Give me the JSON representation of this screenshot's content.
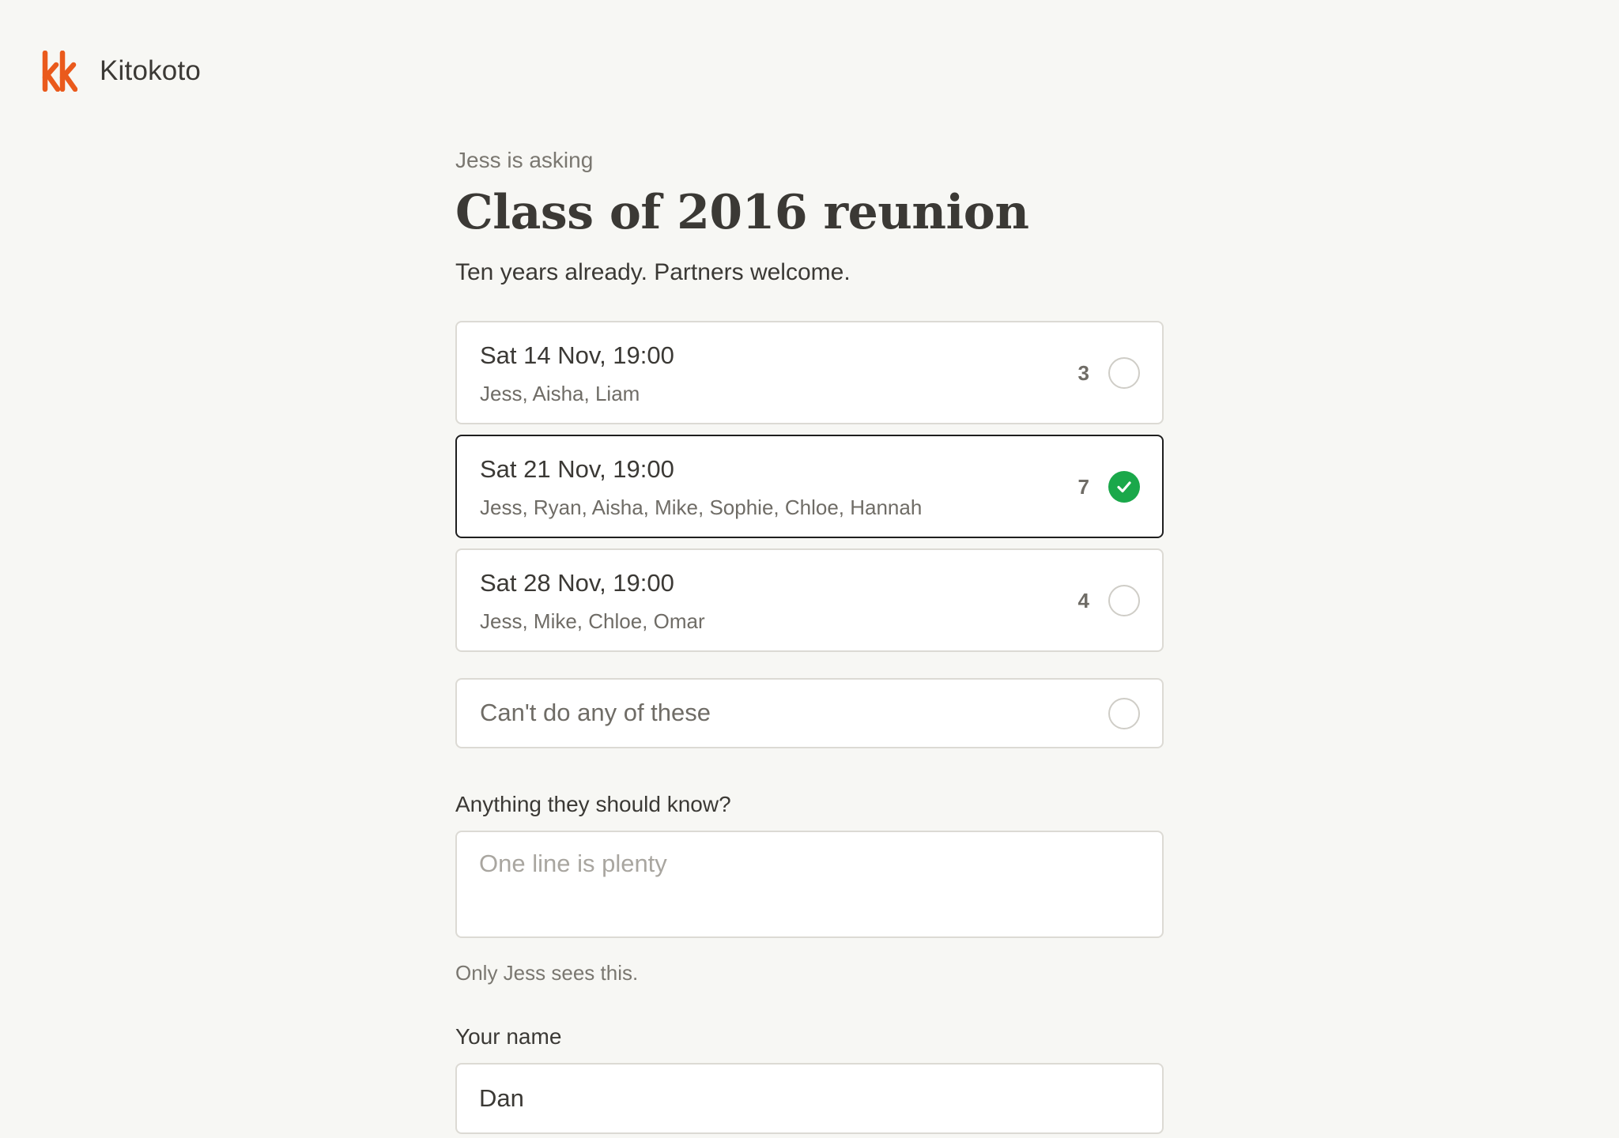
{
  "brand": {
    "name": "Kitokoto",
    "logo_icon": "kk-logo-icon",
    "accent_color": "#ea5a1c"
  },
  "poll": {
    "asker": "Jess is asking",
    "title": "Class of 2016 reunion",
    "description": "Ten years already. Partners welcome."
  },
  "options": [
    {
      "date": "Sat 14 Nov, 19:00",
      "people": "Jess, Aisha, Liam",
      "count": "3",
      "selected": false
    },
    {
      "date": "Sat 21 Nov, 19:00",
      "people": "Jess, Ryan, Aisha, Mike, Sophie, Chloe, Hannah",
      "count": "7",
      "selected": true
    },
    {
      "date": "Sat 28 Nov, 19:00",
      "people": "Jess, Mike, Chloe, Omar",
      "count": "4",
      "selected": false
    }
  ],
  "none_option": {
    "label": "Can't do any of these",
    "selected": false
  },
  "note": {
    "label": "Anything they should know?",
    "placeholder": "One line is plenty",
    "value": "",
    "hint": "Only Jess sees this."
  },
  "name_field": {
    "label": "Your name",
    "value": "Dan"
  },
  "colors": {
    "selected_check": "#1aa84a",
    "selected_border": "#1f1f1f",
    "background": "#f7f7f4"
  }
}
